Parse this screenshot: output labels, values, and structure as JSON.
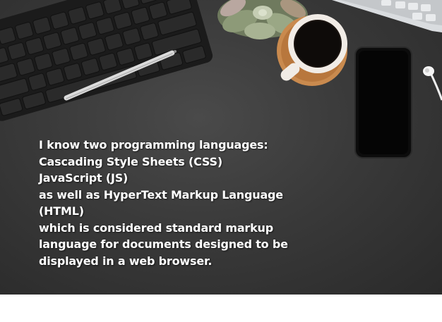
{
  "caption": {
    "lines": [
      "I know two programming languages:",
      "Cascading Style Sheets (CSS)",
      "JavaScript (JS)",
      "as well as HyperText Markup Language",
      "(HTML)",
      "which is considered standard markup",
      "language for documents designed to be",
      "displayed in a web browser."
    ]
  },
  "objects": [
    "keyboard-icon",
    "stylus-pen-icon",
    "succulent-plant-icon",
    "coffee-cup-icon",
    "smartphone-icon",
    "earphone-icon",
    "laptop-icon"
  ],
  "colors": {
    "desk": "#3a3a3a",
    "text": "#ffffff",
    "saucer": "#c98a4e"
  }
}
